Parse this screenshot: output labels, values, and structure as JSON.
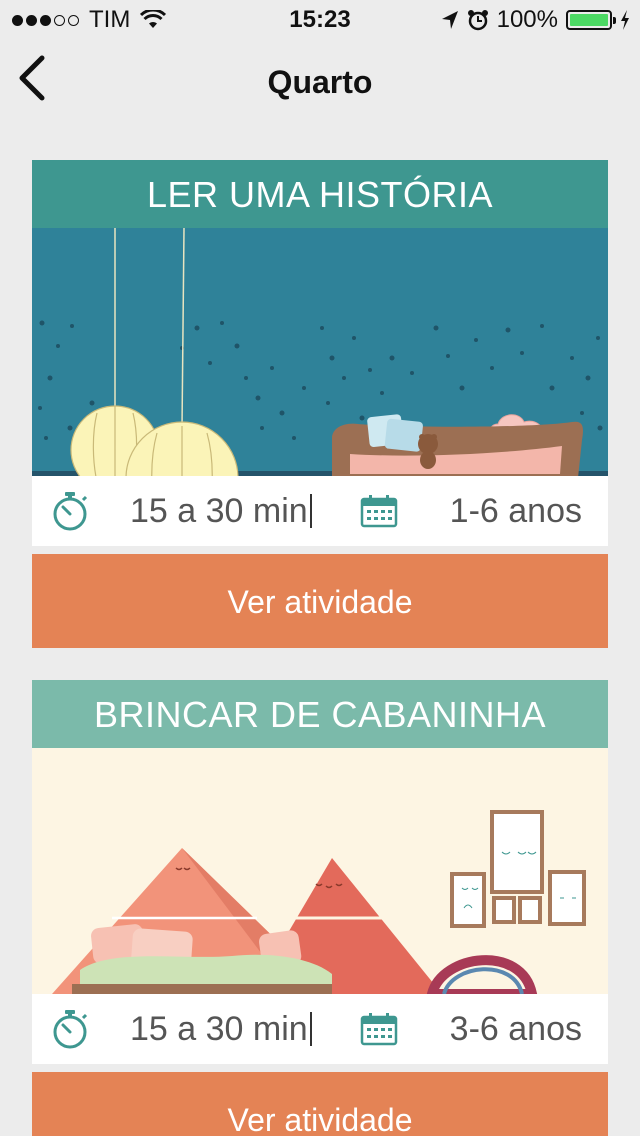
{
  "status_bar": {
    "carrier": "TIM",
    "time": "15:23",
    "battery": "100%",
    "signal_bars_filled": 3,
    "signal_bars_total": 5
  },
  "nav": {
    "title": "Quarto",
    "back_icon": "chevron-left-icon"
  },
  "activities": [
    {
      "title": "LER UMA HISTÓRIA",
      "header_color": "#3e9790",
      "duration": "15 a 30 min",
      "age_range": "1-6 anos",
      "button_label": "Ver atividade"
    },
    {
      "title": "BRINCAR DE CABANINHA",
      "header_color": "#7bbaaa",
      "duration": "15 a 30 min",
      "age_range": "3-6 anos",
      "button_label": "Ver atividade"
    }
  ],
  "colors": {
    "background": "#ececec",
    "button": "#e48355",
    "icon_teal": "#3e9790",
    "battery": "#4cd964"
  }
}
